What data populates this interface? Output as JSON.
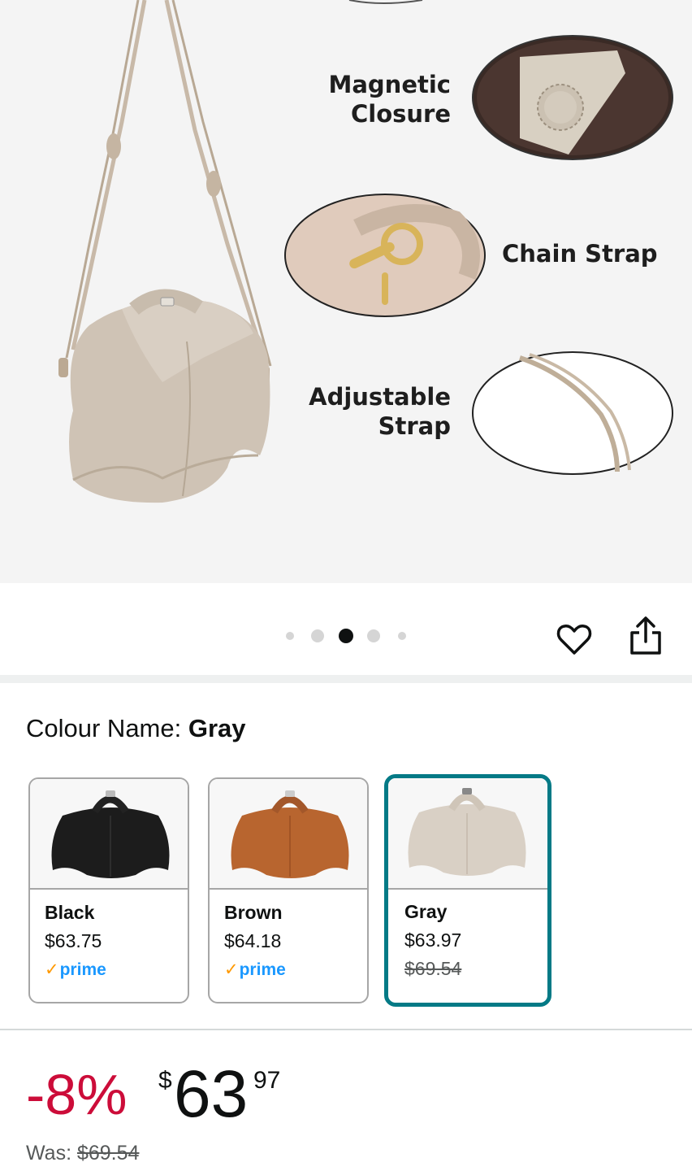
{
  "hero": {
    "callouts": {
      "magnetic": "Magnetic\nClosure",
      "chain": "Chain Strap",
      "adjustable": "Adjustable\nStrap"
    }
  },
  "carousel": {
    "total_images": 5,
    "active_index": 2
  },
  "icons": {
    "wishlist": "heart-icon",
    "share": "share-icon"
  },
  "colour": {
    "label": "Colour Name: ",
    "selected": "Gray"
  },
  "swatches": [
    {
      "name": "Black",
      "price": "$63.75",
      "prime": "prime",
      "bag_color": "#1c1c1c",
      "selected": false
    },
    {
      "name": "Brown",
      "price": "$64.18",
      "prime": "prime",
      "bag_color": "#b8652f",
      "selected": false
    },
    {
      "name": "Gray",
      "price": "$63.97",
      "was": "$69.54",
      "bag_color": "#d9d0c5",
      "selected": true
    }
  ],
  "price": {
    "discount": "-8%",
    "currency": "$",
    "whole": "63",
    "fraction": "97",
    "was_label": "Was: ",
    "was_value": "$69.54"
  },
  "colors": {
    "accent_selected": "#047a86",
    "discount_red": "#cc0c39",
    "prime_blue": "#1a98ff",
    "prime_check": "#ff9900"
  }
}
